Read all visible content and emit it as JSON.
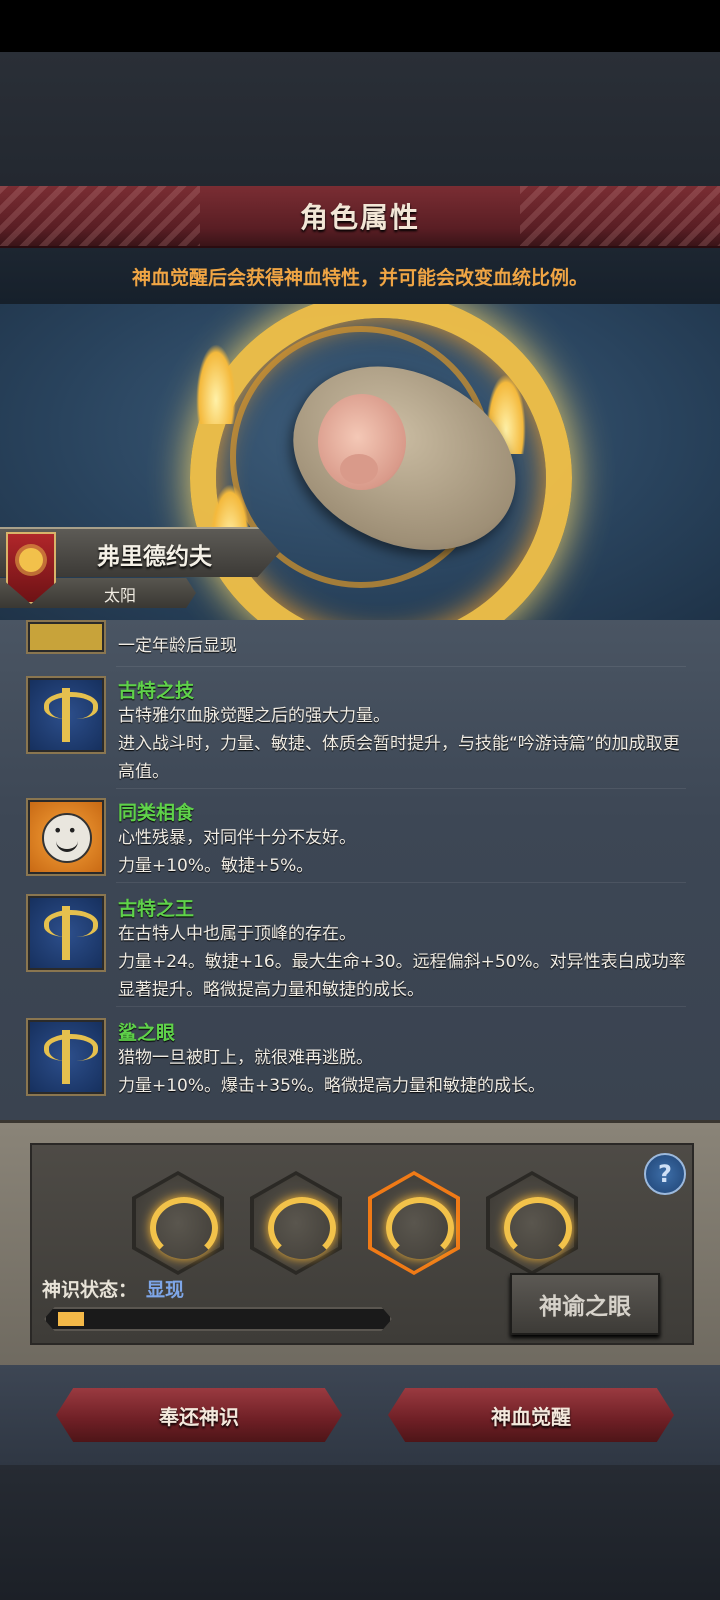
{
  "header": {
    "title": "角色属性"
  },
  "hint": "神血觉醒后会获得神血特性，并可能会改变血统比例。",
  "character": {
    "name": "弗里德约夫",
    "lineage": "太阳"
  },
  "traits": [
    {
      "name": "",
      "desc": "一定年龄后显现",
      "icon": "partial-icon"
    },
    {
      "name": "古特之技",
      "desc": "古特雅尔血脉觉醒之后的强大力量。\n进入战斗时，力量、敏捷、体质会暂时提升，与技能“吟游诗篇”的加成取更高值。",
      "icon": "axe-icon"
    },
    {
      "name": "同类相食",
      "desc": "心性残暴，对同伴十分不友好。\n力量+10%。敏捷+5%。",
      "icon": "smiley-icon"
    },
    {
      "name": "古特之王",
      "desc": "在古特人中也属于顶峰的存在。\n力量+24。敏捷+16。最大生命+30。远程偏斜+50%。对异性表白成功率显著提升。略微提高力量和敏捷的成长。",
      "icon": "axe-icon"
    },
    {
      "name": "鲨之眼",
      "desc": "猎物一旦被盯上，就很难再逃脱。\n力量+10%。爆击+35%。略微提高力量和敏捷的成长。",
      "icon": "axe-icon"
    }
  ],
  "divine": {
    "status_label": "神识状态：",
    "status_value": "显现",
    "progress": 0.08,
    "oracle_button": "神谕之眼",
    "help": "?",
    "slots": [
      {
        "icon": "flame-sigil-icon",
        "active": false
      },
      {
        "icon": "flame-sigil-icon",
        "active": false
      },
      {
        "icon": "flame-sigil-icon",
        "active": true
      },
      {
        "icon": "flame-sigil-icon",
        "active": false
      }
    ]
  },
  "actions": {
    "return_button": "奉还神识",
    "awaken_button": "神血觉醒"
  },
  "colors": {
    "accent": "#f0a544",
    "trait_name": "#5fd24a",
    "status_value": "#7ea6e8"
  }
}
